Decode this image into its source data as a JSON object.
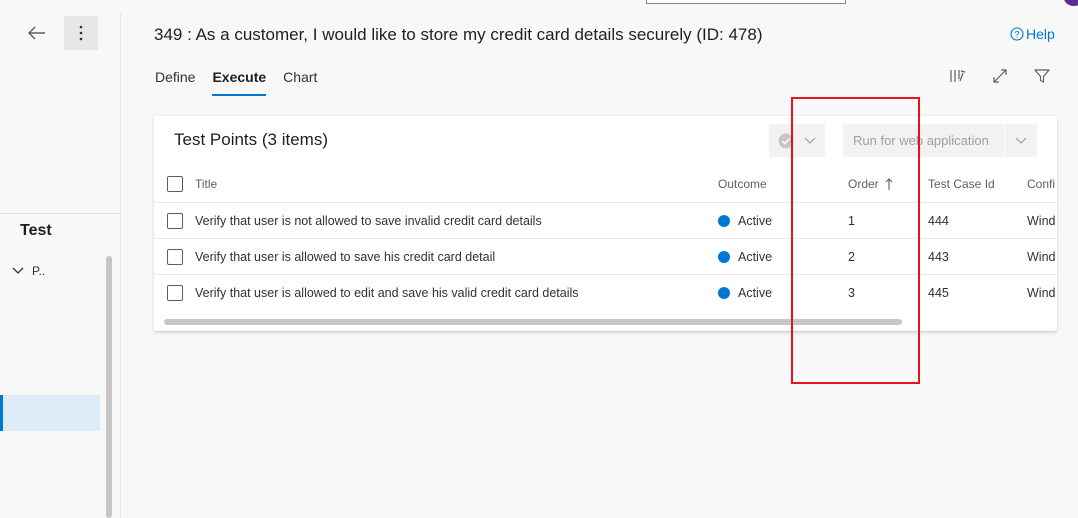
{
  "window": {
    "title": "349 : As a customer, I would like to store my credit card details securely (ID: 478)",
    "help_label": "Help"
  },
  "left_pane": {
    "title": "Test",
    "tree_item": "P..",
    "icons": [
      "back-arrow-icon",
      "more-vertical-icon",
      "chevron-down-icon"
    ]
  },
  "tabs": [
    {
      "label": "Define",
      "active": false
    },
    {
      "label": "Execute",
      "active": true
    },
    {
      "label": "Chart",
      "active": false
    }
  ],
  "header_icons": [
    "column-options-icon",
    "fullscreen-icon",
    "filter-icon"
  ],
  "test_points": {
    "title": "Test Points (3 items)",
    "run_button_label": "Run for web application",
    "columns": [
      "Title",
      "Outcome",
      "Order",
      "Test Case Id",
      "Confi"
    ],
    "sort_column": "Order",
    "sort_direction": "ascending",
    "rows": [
      {
        "title": "Verify that user is not allowed to save invalid credit card details",
        "outcome": "Active",
        "order": "1",
        "test_case_id": "444",
        "config": "Wind"
      },
      {
        "title": "Verify that user is allowed to save his credit card detail",
        "outcome": "Active",
        "order": "2",
        "test_case_id": "443",
        "config": "Wind"
      },
      {
        "title": "Verify that user is allowed to edit and save his valid credit card details",
        "outcome": "Active",
        "order": "3",
        "test_case_id": "445",
        "config": "Wind"
      }
    ]
  },
  "colors": {
    "accent": "#0078d4",
    "highlight_box": "#e81123",
    "active_dot": "#0078d4"
  }
}
